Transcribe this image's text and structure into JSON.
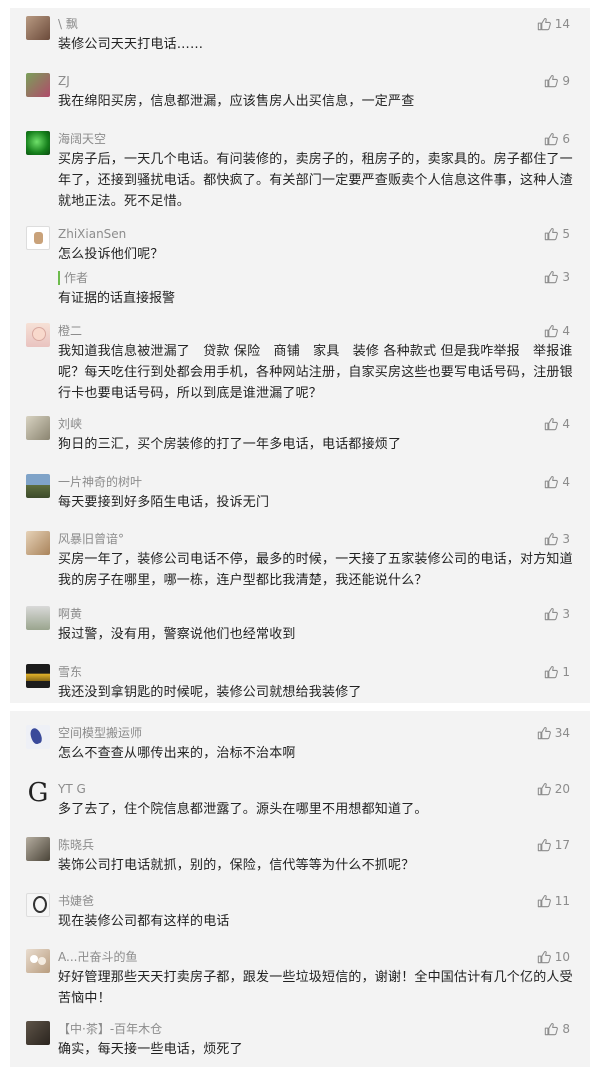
{
  "comments_top": [
    {
      "name": "\\ 飘",
      "likes": "14",
      "text": "装修公司天天打电话……"
    },
    {
      "name": "ZJ",
      "likes": "9",
      "text": "我在绵阳买房，信息都泄漏，应该售房人出买信息，一定严查"
    },
    {
      "name": "海阔天空",
      "likes": "6",
      "text": "买房子后，一天几个电话。有问装修的，卖房子的，租房子的，卖家具的。房子都住了一年了，还接到骚扰电话。都快疯了。有关部门一定要严查贩卖个人信息这件事，这种人渣就地正法。死不足惜。"
    },
    {
      "name": "ZhiXianSen",
      "likes": "5",
      "text": "怎么投诉他们呢？",
      "reply": {
        "label": "作者",
        "likes": "3",
        "text": "有证据的话直接报警"
      }
    },
    {
      "name": "橙二",
      "likes": "4",
      "text": "我知道我信息被泄漏了　贷款 保险　商铺　家具　装修 各种款式 但是我咋举报　举报谁呢？每天吃住行到处都会用手机，各种网站注册，自家买房这些也要写电话号码，注册银行卡也要电话号码，所以到底是谁泄漏了呢？"
    },
    {
      "name": "刘峡",
      "likes": "4",
      "text": "狗日的三汇，买个房装修的打了一年多电话，电话都接烦了"
    },
    {
      "name": "一片神奇的树叶",
      "likes": "4",
      "text": "每天要接到好多陌生电话，投诉无门"
    },
    {
      "name": "风暴旧曾谙°",
      "likes": "3",
      "text": "买房一年了，装修公司电话不停，最多的时候，一天接了五家装修公司的电话，对方知道我的房子在哪里，哪一栋，连户型都比我清楚，我还能说什么？"
    },
    {
      "name": "啊黄",
      "likes": "3",
      "text": "报过警，没有用，警察说他们也经常收到"
    },
    {
      "name": "雪东",
      "likes": "1",
      "text": "我还没到拿钥匙的时候呢，装修公司就想给我装修了"
    }
  ],
  "comments_bottom": [
    {
      "name": "空间模型搬运师",
      "likes": "34",
      "text": "怎么不查查从哪传出来的，治标不治本啊"
    },
    {
      "name": "YT G",
      "likes": "20",
      "text": "多了去了，住个院信息都泄露了。源头在哪里不用想都知道了。"
    },
    {
      "name": "陈晓兵",
      "likes": "17",
      "text": "装饰公司打电话就抓，别的，保险，信代等等为什么不抓呢？"
    },
    {
      "name": "书婕爸",
      "likes": "11",
      "text": "现在装修公司都有这样的电话"
    },
    {
      "name": "A...卍奋斗的鱼",
      "likes": "10",
      "text": "好好管理那些天天打卖房子都，跟发一些垃圾短信的，谢谢！全中国估计有几个亿的人受苦恼中！"
    },
    {
      "name": "【中·茶】-百年木仓",
      "likes": "8",
      "text": "确实，每天接一些电话，烦死了"
    }
  ],
  "colors": {
    "panel_bg": "#f3f3f3",
    "meta_text": "#8c8c8c",
    "body_text": "#222222",
    "reply_bar": "#6dbb4c"
  },
  "icons": {
    "like": "thumbs-up-icon"
  }
}
